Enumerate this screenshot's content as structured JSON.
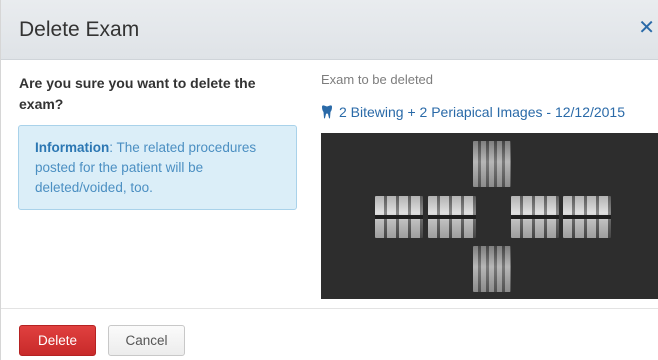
{
  "dialog": {
    "title": "Delete Exam",
    "close_glyph": "✕"
  },
  "confirm": {
    "question": "Are you sure you want to delete the exam?",
    "info_label": "Information",
    "info_text": ": The related procedures posted for the patient will be deleted/voided, too."
  },
  "exam": {
    "heading": "Exam to be deleted",
    "link_text": "2 Bitewing + 2 Periapical Images - 12/12/2015",
    "icon": "tooth-icon",
    "image_count": 6
  },
  "footer": {
    "delete_label": "Delete",
    "cancel_label": "Cancel"
  },
  "colors": {
    "accent_blue": "#2a6aa8",
    "danger_red": "#d33a3a",
    "info_bg": "#dbeef8"
  }
}
